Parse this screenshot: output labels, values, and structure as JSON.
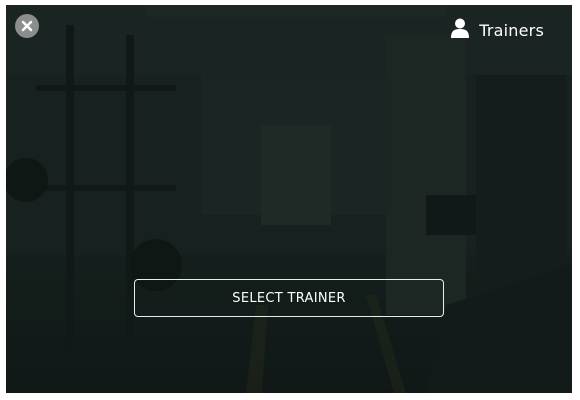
{
  "header": {
    "close_icon": "close-icon",
    "trainers_icon": "user-icon",
    "trainers_label": "Trainers"
  },
  "main": {
    "select_trainer_label": "SELECT TRAINER"
  },
  "colors": {
    "background": "#1c2624",
    "close_button": "#8a8f8e",
    "text": "#ffffff"
  }
}
